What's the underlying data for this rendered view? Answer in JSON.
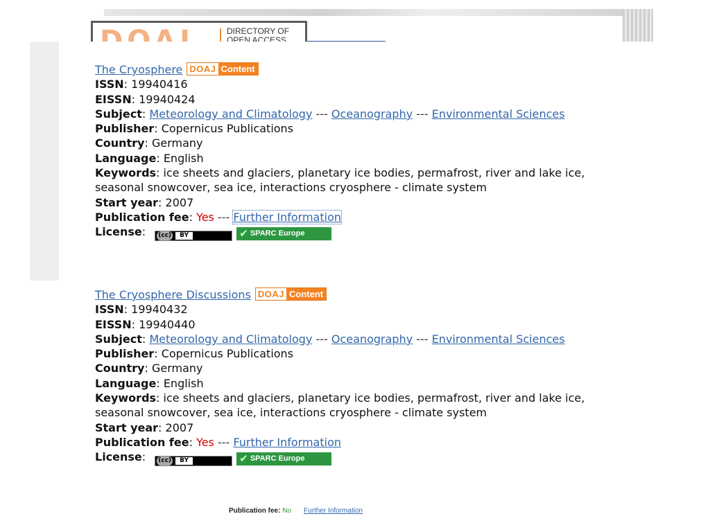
{
  "header": {
    "logo_letters": "DOAJ",
    "logo_caption_line1": "DIRECTORY OF",
    "logo_caption_line2": "OPEN ACCESS"
  },
  "badges": {
    "doaj_left": "DOAJ",
    "doaj_right": "Content",
    "cc_mark": "(cc)",
    "cc_by": "BY",
    "sparc": "SPARC Europe"
  },
  "labels": {
    "issn": "ISSN",
    "eissn": "EISSN",
    "subject": "Subject",
    "publisher": "Publisher",
    "country": "Country",
    "language": "Language",
    "keywords": "Keywords",
    "start_year": "Start year",
    "publication_fee": "Publication fee",
    "license": "License",
    "further_info": "Further Information",
    "subject_sep": "---"
  },
  "records": [
    {
      "title": "The Cryosphere",
      "issn": "19940416",
      "eissn": "19940424",
      "subjects": [
        "Meteorology and Climatology",
        "Oceanography",
        "Environmental Sciences"
      ],
      "publisher": "Copernicus Publications",
      "country": "Germany",
      "language": "English",
      "keywords": "ice sheets and glaciers, planetary ice bodies, permafrost, river and lake ice, seasonal snowcover, sea ice, interactions cryosphere - climate system",
      "start_year": "2007",
      "publication_fee": "Yes"
    },
    {
      "title": "The Cryosphere Discussions",
      "issn": "19940432",
      "eissn": "19940440",
      "subjects": [
        "Meteorology and Climatology",
        "Oceanography",
        "Environmental Sciences"
      ],
      "publisher": "Copernicus Publications",
      "country": "Germany",
      "language": "English",
      "keywords": "ice sheets and glaciers, planetary ice bodies, permafrost, river and lake ice, seasonal snowcover, sea ice, interactions cryosphere - climate system",
      "start_year": "2007",
      "publication_fee": "Yes"
    }
  ],
  "background_row": {
    "label": "Publication fee:",
    "value": "No",
    "link": "Further Information"
  },
  "colors": {
    "link": "#3366aa",
    "fee_yes": "#d40000",
    "doaj_orange": "#f58220",
    "sparc_green": "#2c9640"
  }
}
